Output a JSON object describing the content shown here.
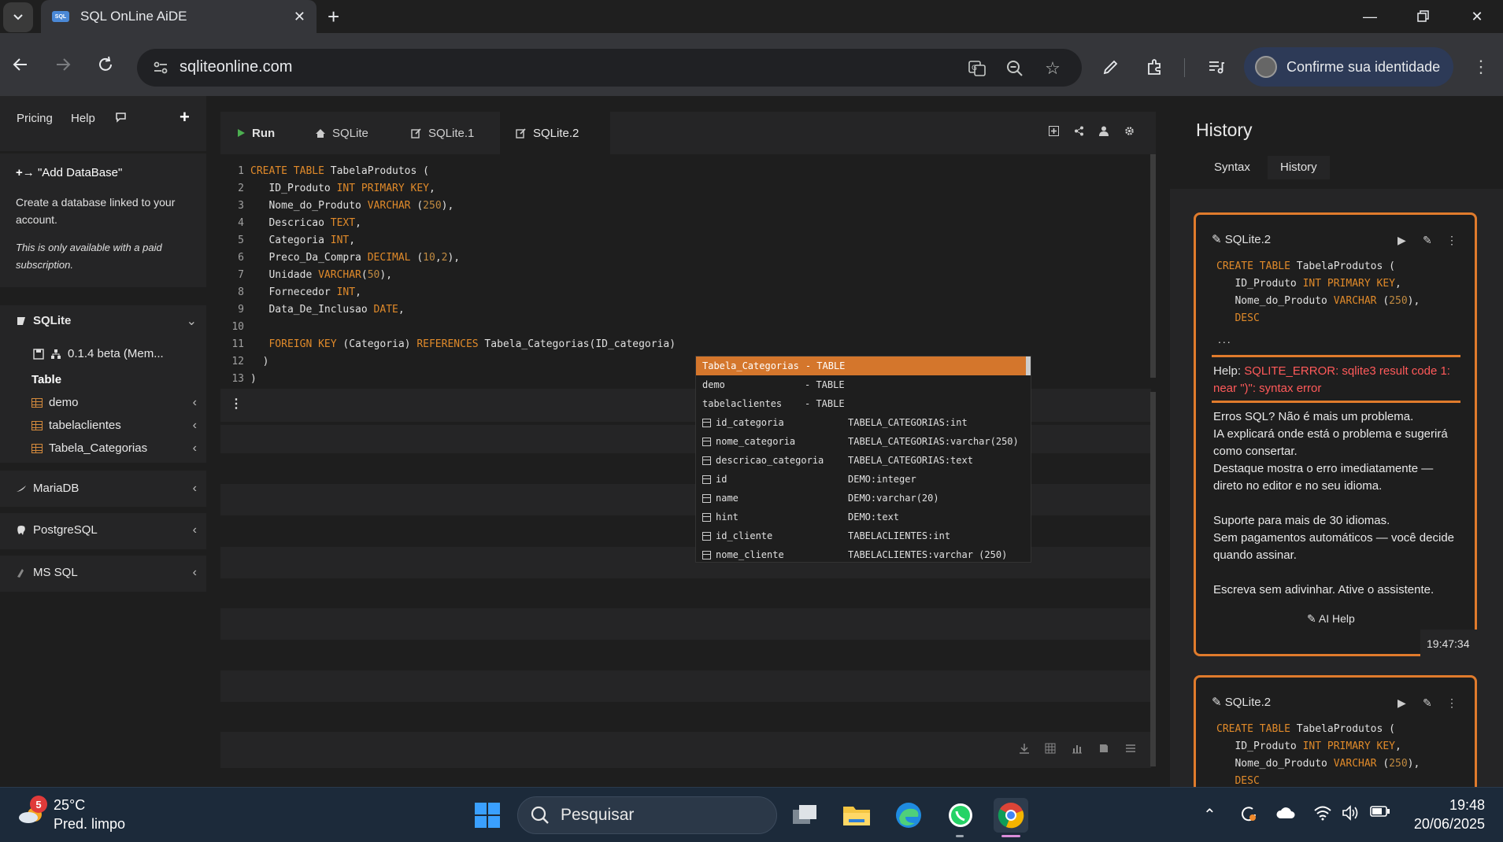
{
  "browser": {
    "tab_title": "SQL OnLine AiDE",
    "favicon_text": "SQL",
    "url": "sqliteonline.com",
    "profile_label": "Confirme sua identidade"
  },
  "nav": {
    "pricing": "Pricing",
    "help": "Help",
    "add_label": "+"
  },
  "info_card": {
    "title": "\"Add DataBase\"",
    "desc": "Create a database linked to your account.",
    "note": "This is only available with a paid subscription."
  },
  "sidebar": {
    "sqlite_label": "SQLite",
    "version": "0.1.4 beta (Mem...",
    "table_header": "Table",
    "tables": [
      "demo",
      "tabelaclientes",
      "Tabela_Categorias"
    ],
    "dbs": [
      "MariaDB",
      "PostgreSQL",
      "MS SQL"
    ]
  },
  "editor_tabs": {
    "run": "Run",
    "tabs": [
      "SQLite",
      "SQLite.1",
      "SQLite.2"
    ]
  },
  "editor": {
    "lines": [
      {
        "n": "1"
      },
      {
        "n": "2"
      },
      {
        "n": "3"
      },
      {
        "n": "4"
      },
      {
        "n": "5"
      },
      {
        "n": "6"
      },
      {
        "n": "7"
      },
      {
        "n": "8"
      },
      {
        "n": "9"
      },
      {
        "n": "10"
      },
      {
        "n": "11"
      },
      {
        "n": "12"
      },
      {
        "n": "13"
      }
    ]
  },
  "autocomplete": [
    {
      "name": "Tabela_Categorias",
      "type": "- TABLE"
    },
    {
      "name": "demo",
      "type": "- TABLE"
    },
    {
      "name": "tabelaclientes",
      "type": "- TABLE"
    },
    {
      "name": "id_categoria",
      "type": "TABELA_CATEGORIAS:int"
    },
    {
      "name": "nome_categoria",
      "type": "TABELA_CATEGORIAS:varchar(250)"
    },
    {
      "name": "descricao_categoria",
      "type": "TABELA_CATEGORIAS:text"
    },
    {
      "name": "id",
      "type": "DEMO:integer"
    },
    {
      "name": "name",
      "type": "DEMO:varchar(20)"
    },
    {
      "name": "hint",
      "type": "DEMO:text"
    },
    {
      "name": "id_cliente",
      "type": "TABELACLIENTES:int"
    },
    {
      "name": "nome_cliente",
      "type": "TABELACLIENTES:varchar (250)"
    }
  ],
  "history": {
    "title": "History",
    "tabs": [
      "Syntax",
      "History"
    ],
    "card1": {
      "name": "SQLite.2",
      "ellipsis": "...",
      "help_label": "Help:",
      "error": "SQLITE_ERROR: sqlite3 result code 1: near \")\": syntax error",
      "promo1": "Erros SQL? Não é mais um problema.",
      "promo2": "IA explicará onde está o problema e sugerirá como consertar.",
      "promo3": "Destaque mostra o erro imediatamente — direto no editor e no seu idioma.",
      "promo4": "Suporte para mais de 30 idiomas.",
      "promo5": "Sem pagamentos automáticos — você decide quando assinar.",
      "promo6": "Escreva sem adivinhar. Ative o assistente.",
      "ai_help": "AI Help",
      "time": "19:47:34"
    },
    "card2": {
      "name": "SQLite.2"
    }
  },
  "taskbar": {
    "badge": "5",
    "temp": "25°C",
    "condition": "Pred. limpo",
    "search": "Pesquisar",
    "time": "19:48",
    "date": "20/06/2025"
  }
}
